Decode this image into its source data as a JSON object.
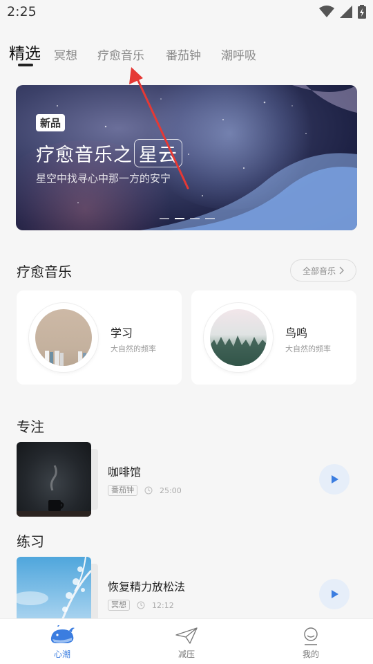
{
  "status": {
    "time": "2:25"
  },
  "tabs": [
    {
      "label": "精选"
    },
    {
      "label": "冥想"
    },
    {
      "label": "疗愈音乐"
    },
    {
      "label": "番茄钟"
    },
    {
      "label": "潮呼吸"
    }
  ],
  "banner": {
    "badge": "新品",
    "title_prefix": "疗愈音乐之",
    "title_highlight": "星云",
    "subtitle": "星空中找寻心中那一方的安宁",
    "active_dot": 2,
    "dot_count": 4
  },
  "healing_music": {
    "title": "疗愈音乐",
    "all_button": "全部音乐",
    "items": [
      {
        "name": "学习",
        "desc": "大自然的频率"
      },
      {
        "name": "鸟鸣",
        "desc": "大自然的频率"
      }
    ]
  },
  "focus": {
    "title": "专注",
    "item": {
      "title": "咖啡馆",
      "tag": "番茄钟",
      "duration": "25:00"
    }
  },
  "practice": {
    "title": "练习",
    "item": {
      "title": "恢复精力放松法",
      "tag": "冥想",
      "duration": "12:12"
    }
  },
  "bottom_nav": [
    {
      "label": "心潮",
      "active": true
    },
    {
      "label": "减压",
      "active": false
    },
    {
      "label": "我的",
      "active": false
    }
  ],
  "colors": {
    "accent": "#3b7de0",
    "play_bg": "#e6eef9",
    "annotation": "#e53935"
  }
}
